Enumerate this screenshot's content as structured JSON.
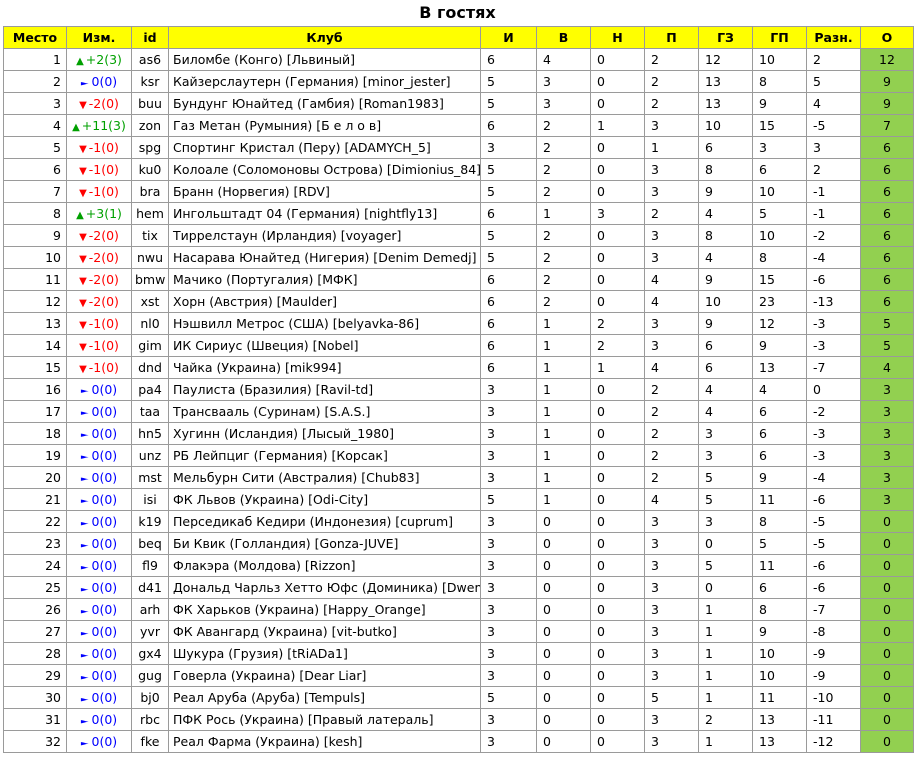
{
  "title": "В гостях",
  "columns": [
    "Место",
    "Изм.",
    "id",
    "Клуб",
    "И",
    "В",
    "Н",
    "П",
    "ГЗ",
    "ГП",
    "Разн.",
    "О"
  ],
  "colors": {
    "header_bg": "#ffff00",
    "points_bg": "#92d050",
    "up": "#00a000",
    "down": "#ff0000",
    "same": "#0000ff"
  },
  "rows": [
    {
      "place": "1",
      "dir": "up",
      "change": "+2(3)",
      "id": "as6",
      "club": "Биломбе (Конго) [Львиный]",
      "g": "6",
      "w": "4",
      "d": "0",
      "l": "2",
      "gf": "12",
      "ga": "10",
      "diff": "2",
      "pts": "12"
    },
    {
      "place": "2",
      "dir": "same",
      "change": "0(0)",
      "id": "ksr",
      "club": "Кайзерслаутерн (Германия) [minor_jester]",
      "g": "5",
      "w": "3",
      "d": "0",
      "l": "2",
      "gf": "13",
      "ga": "8",
      "diff": "5",
      "pts": "9"
    },
    {
      "place": "3",
      "dir": "down",
      "change": "-2(0)",
      "id": "buu",
      "club": "Бундунг Юнайтед (Гамбия) [Roman1983]",
      "g": "5",
      "w": "3",
      "d": "0",
      "l": "2",
      "gf": "13",
      "ga": "9",
      "diff": "4",
      "pts": "9"
    },
    {
      "place": "4",
      "dir": "up",
      "change": "+11(3)",
      "id": "zon",
      "club": "Газ Метан (Румыния) [Б е л о в]",
      "g": "6",
      "w": "2",
      "d": "1",
      "l": "3",
      "gf": "10",
      "ga": "15",
      "diff": "-5",
      "pts": "7"
    },
    {
      "place": "5",
      "dir": "down",
      "change": "-1(0)",
      "id": "spg",
      "club": "Спортинг Кристал (Перу) [ADAMYCH_5]",
      "g": "3",
      "w": "2",
      "d": "0",
      "l": "1",
      "gf": "6",
      "ga": "3",
      "diff": "3",
      "pts": "6"
    },
    {
      "place": "6",
      "dir": "down",
      "change": "-1(0)",
      "id": "ku0",
      "club": "Колоале (Соломоновы Острова) [Dimionius_84]",
      "g": "5",
      "w": "2",
      "d": "0",
      "l": "3",
      "gf": "8",
      "ga": "6",
      "diff": "2",
      "pts": "6"
    },
    {
      "place": "7",
      "dir": "down",
      "change": "-1(0)",
      "id": "bra",
      "club": "Бранн (Норвегия) [RDV]",
      "g": "5",
      "w": "2",
      "d": "0",
      "l": "3",
      "gf": "9",
      "ga": "10",
      "diff": "-1",
      "pts": "6"
    },
    {
      "place": "8",
      "dir": "up",
      "change": "+3(1)",
      "id": "hem",
      "club": "Ингольштадт 04 (Германия) [nightfly13]",
      "g": "6",
      "w": "1",
      "d": "3",
      "l": "2",
      "gf": "4",
      "ga": "5",
      "diff": "-1",
      "pts": "6"
    },
    {
      "place": "9",
      "dir": "down",
      "change": "-2(0)",
      "id": "tix",
      "club": "Тиррелстаун (Ирландия) [voyager]",
      "g": "5",
      "w": "2",
      "d": "0",
      "l": "3",
      "gf": "8",
      "ga": "10",
      "diff": "-2",
      "pts": "6"
    },
    {
      "place": "10",
      "dir": "down",
      "change": "-2(0)",
      "id": "nwu",
      "club": "Насарава Юнайтед (Нигерия) [Denim Demedj]",
      "g": "5",
      "w": "2",
      "d": "0",
      "l": "3",
      "gf": "4",
      "ga": "8",
      "diff": "-4",
      "pts": "6"
    },
    {
      "place": "11",
      "dir": "down",
      "change": "-2(0)",
      "id": "bmw",
      "club": "Мачико (Португалия) [МФК]",
      "g": "6",
      "w": "2",
      "d": "0",
      "l": "4",
      "gf": "9",
      "ga": "15",
      "diff": "-6",
      "pts": "6"
    },
    {
      "place": "12",
      "dir": "down",
      "change": "-2(0)",
      "id": "xst",
      "club": "Хорн (Австрия) [Maulder]",
      "g": "6",
      "w": "2",
      "d": "0",
      "l": "4",
      "gf": "10",
      "ga": "23",
      "diff": "-13",
      "pts": "6"
    },
    {
      "place": "13",
      "dir": "down",
      "change": "-1(0)",
      "id": "nl0",
      "club": "Нэшвилл Метрос (США) [belyavka-86]",
      "g": "6",
      "w": "1",
      "d": "2",
      "l": "3",
      "gf": "9",
      "ga": "12",
      "diff": "-3",
      "pts": "5"
    },
    {
      "place": "14",
      "dir": "down",
      "change": "-1(0)",
      "id": "gim",
      "club": "ИК Сириус (Швеция) [Nobel]",
      "g": "6",
      "w": "1",
      "d": "2",
      "l": "3",
      "gf": "6",
      "ga": "9",
      "diff": "-3",
      "pts": "5"
    },
    {
      "place": "15",
      "dir": "down",
      "change": "-1(0)",
      "id": "dnd",
      "club": "Чайка (Украина) [mik994]",
      "g": "6",
      "w": "1",
      "d": "1",
      "l": "4",
      "gf": "6",
      "ga": "13",
      "diff": "-7",
      "pts": "4"
    },
    {
      "place": "16",
      "dir": "same",
      "change": "0(0)",
      "id": "pa4",
      "club": "Паулиста (Бразилия) [Ravil-td]",
      "g": "3",
      "w": "1",
      "d": "0",
      "l": "2",
      "gf": "4",
      "ga": "4",
      "diff": "0",
      "pts": "3"
    },
    {
      "place": "17",
      "dir": "same",
      "change": "0(0)",
      "id": "taa",
      "club": "Трансвааль (Суринам) [S.A.S.]",
      "g": "3",
      "w": "1",
      "d": "0",
      "l": "2",
      "gf": "4",
      "ga": "6",
      "diff": "-2",
      "pts": "3"
    },
    {
      "place": "18",
      "dir": "same",
      "change": "0(0)",
      "id": "hn5",
      "club": "Хугинн (Исландия) [Лысый_1980]",
      "g": "3",
      "w": "1",
      "d": "0",
      "l": "2",
      "gf": "3",
      "ga": "6",
      "diff": "-3",
      "pts": "3"
    },
    {
      "place": "19",
      "dir": "same",
      "change": "0(0)",
      "id": "unz",
      "club": "РБ Лейпциг (Германия) [Корсак]",
      "g": "3",
      "w": "1",
      "d": "0",
      "l": "2",
      "gf": "3",
      "ga": "6",
      "diff": "-3",
      "pts": "3"
    },
    {
      "place": "20",
      "dir": "same",
      "change": "0(0)",
      "id": "mst",
      "club": "Мельбурн Сити (Австралия) [Chub83]",
      "g": "3",
      "w": "1",
      "d": "0",
      "l": "2",
      "gf": "5",
      "ga": "9",
      "diff": "-4",
      "pts": "3"
    },
    {
      "place": "21",
      "dir": "same",
      "change": "0(0)",
      "id": "isi",
      "club": "ФК Львов (Украина) [Odi-City]",
      "g": "5",
      "w": "1",
      "d": "0",
      "l": "4",
      "gf": "5",
      "ga": "11",
      "diff": "-6",
      "pts": "3"
    },
    {
      "place": "22",
      "dir": "same",
      "change": "0(0)",
      "id": "k19",
      "club": "Перседикаб Кедири (Индонезия) [cuprum]",
      "g": "3",
      "w": "0",
      "d": "0",
      "l": "3",
      "gf": "3",
      "ga": "8",
      "diff": "-5",
      "pts": "0"
    },
    {
      "place": "23",
      "dir": "same",
      "change": "0(0)",
      "id": "beq",
      "club": "Би Квик (Голландия) [Gonza-JUVE]",
      "g": "3",
      "w": "0",
      "d": "0",
      "l": "3",
      "gf": "0",
      "ga": "5",
      "diff": "-5",
      "pts": "0"
    },
    {
      "place": "24",
      "dir": "same",
      "change": "0(0)",
      "id": "fl9",
      "club": "Флакэра (Молдова) [Rizzon]",
      "g": "3",
      "w": "0",
      "d": "0",
      "l": "3",
      "gf": "5",
      "ga": "11",
      "diff": "-6",
      "pts": "0"
    },
    {
      "place": "25",
      "dir": "same",
      "change": "0(0)",
      "id": "d41",
      "club": "Дональд Чарльз Хетто Юфс (Доминика) [Dwem]",
      "g": "3",
      "w": "0",
      "d": "0",
      "l": "3",
      "gf": "0",
      "ga": "6",
      "diff": "-6",
      "pts": "0"
    },
    {
      "place": "26",
      "dir": "same",
      "change": "0(0)",
      "id": "arh",
      "club": "ФК Харьков (Украина) [Happy_Orange]",
      "g": "3",
      "w": "0",
      "d": "0",
      "l": "3",
      "gf": "1",
      "ga": "8",
      "diff": "-7",
      "pts": "0"
    },
    {
      "place": "27",
      "dir": "same",
      "change": "0(0)",
      "id": "yvr",
      "club": "ФК Авангард (Украина) [vit-butko]",
      "g": "3",
      "w": "0",
      "d": "0",
      "l": "3",
      "gf": "1",
      "ga": "9",
      "diff": "-8",
      "pts": "0"
    },
    {
      "place": "28",
      "dir": "same",
      "change": "0(0)",
      "id": "gx4",
      "club": "Шукура (Грузия) [tRiADa1]",
      "g": "3",
      "w": "0",
      "d": "0",
      "l": "3",
      "gf": "1",
      "ga": "10",
      "diff": "-9",
      "pts": "0"
    },
    {
      "place": "29",
      "dir": "same",
      "change": "0(0)",
      "id": "gug",
      "club": "Говерла (Украина) [Dear Liar]",
      "g": "3",
      "w": "0",
      "d": "0",
      "l": "3",
      "gf": "1",
      "ga": "10",
      "diff": "-9",
      "pts": "0"
    },
    {
      "place": "30",
      "dir": "same",
      "change": "0(0)",
      "id": "bj0",
      "club": "Реал Аруба (Аруба) [Tempuls]",
      "g": "5",
      "w": "0",
      "d": "0",
      "l": "5",
      "gf": "1",
      "ga": "11",
      "diff": "-10",
      "pts": "0"
    },
    {
      "place": "31",
      "dir": "same",
      "change": "0(0)",
      "id": "rbc",
      "club": "ПФК Рось (Украина) [Правый латераль]",
      "g": "3",
      "w": "0",
      "d": "0",
      "l": "3",
      "gf": "2",
      "ga": "13",
      "diff": "-11",
      "pts": "0"
    },
    {
      "place": "32",
      "dir": "same",
      "change": "0(0)",
      "id": "fke",
      "club": "Реал Фарма (Украина) [kesh]",
      "g": "3",
      "w": "0",
      "d": "0",
      "l": "3",
      "gf": "1",
      "ga": "13",
      "diff": "-12",
      "pts": "0"
    }
  ]
}
